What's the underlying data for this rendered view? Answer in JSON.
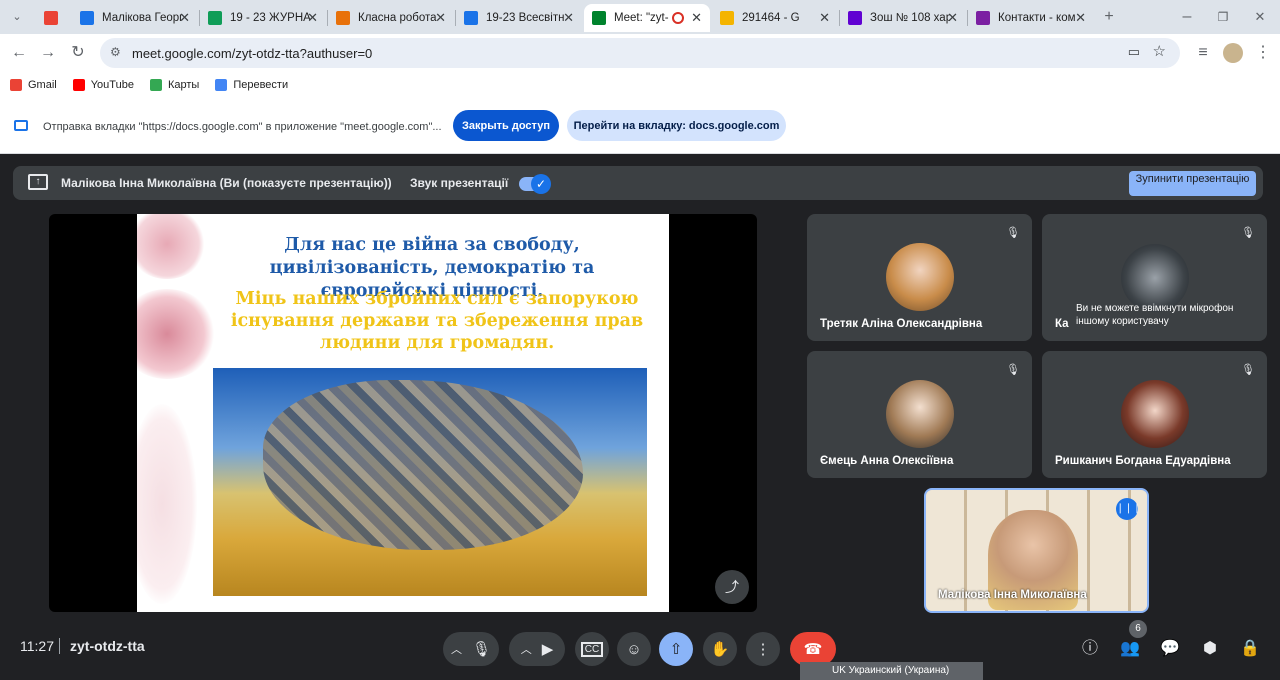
{
  "browser": {
    "tabs": [
      {
        "title": "",
        "color": "#ea4335"
      },
      {
        "title": "Малікова Георг",
        "color": "#1a73e8"
      },
      {
        "title": "19 - 23 ЖУРНА",
        "color": "#0f9d58"
      },
      {
        "title": "Класна робота",
        "color": "#e8710a"
      },
      {
        "title": "19-23 Всесвітн",
        "color": "#1a73e8"
      },
      {
        "title": "Meet: \"zyt-",
        "color": "#00832d"
      },
      {
        "title": "291464 - G",
        "color": "#f4b400"
      },
      {
        "title": "Зош № 108 хар",
        "color": "#6001d2"
      },
      {
        "title": "Контакти - ком",
        "color": "#7b1fa2"
      }
    ],
    "url": "meet.google.com/zyt-otdz-tta?authuser=0",
    "bookmarks": [
      {
        "label": "Gmail",
        "color": "#ea4335"
      },
      {
        "label": "YouTube",
        "color": "#ff0000"
      },
      {
        "label": "Карты",
        "color": "#34a853"
      },
      {
        "label": "Перевести",
        "color": "#4285f4"
      }
    ],
    "infobar": {
      "message": "Отправка вкладки \"https://docs.google.com\" в приложение \"meet.google.com\"...",
      "close_access": "Закрыть доступ",
      "go_to_tab": "Перейти на вкладку: docs.google.com"
    }
  },
  "meet": {
    "presenter_banner": "Малікова Інна Миколаївна (Ви (показуєте презентацію))",
    "presentation_sound": "Звук презентації",
    "stop_presentation": "Зупинити презентацію",
    "slide": {
      "title": "Для нас це війна за свободу, цивілізованість, демократію та європейські цінності.",
      "subtitle": "Міць наших збройних сил є запорукою існування держави та збереження прав людини для громадян."
    },
    "participants": [
      {
        "name": "Третяк Аліна Олександрівна",
        "note": ""
      },
      {
        "name": "Ка",
        "note": "Ви не можете ввімкнути мікрофон іншому користувачу"
      },
      {
        "name": "Ємець Анна Олексіївна",
        "note": ""
      },
      {
        "name": "Ришканич Богдана Едуардівна",
        "note": ""
      }
    ],
    "self_name": "Малікова Інна Миколаївна",
    "time": "11:27",
    "meeting_code": "zyt-otdz-tta",
    "participants_count": "6",
    "language_bar": "UK Украинский (Украина)"
  }
}
